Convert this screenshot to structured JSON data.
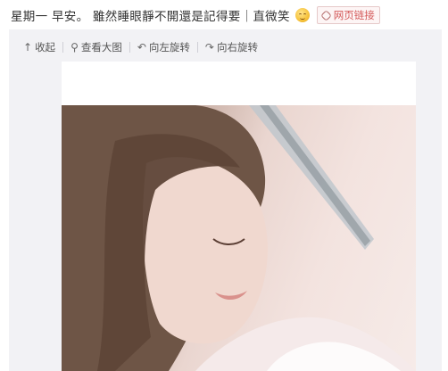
{
  "post": {
    "text": "星期一 早安。 雖然睡眼靜不開還是記得要｜直微笑",
    "emoji": "smile-emoji",
    "link_label": "网页链接"
  },
  "toolbar": {
    "collapse": "收起",
    "view_large": "查看大图",
    "rotate_left": "向左旋转",
    "rotate_right": "向右旋转"
  },
  "colors": {
    "panel_bg": "#f2f2f5",
    "link_text": "#d45a5a"
  }
}
